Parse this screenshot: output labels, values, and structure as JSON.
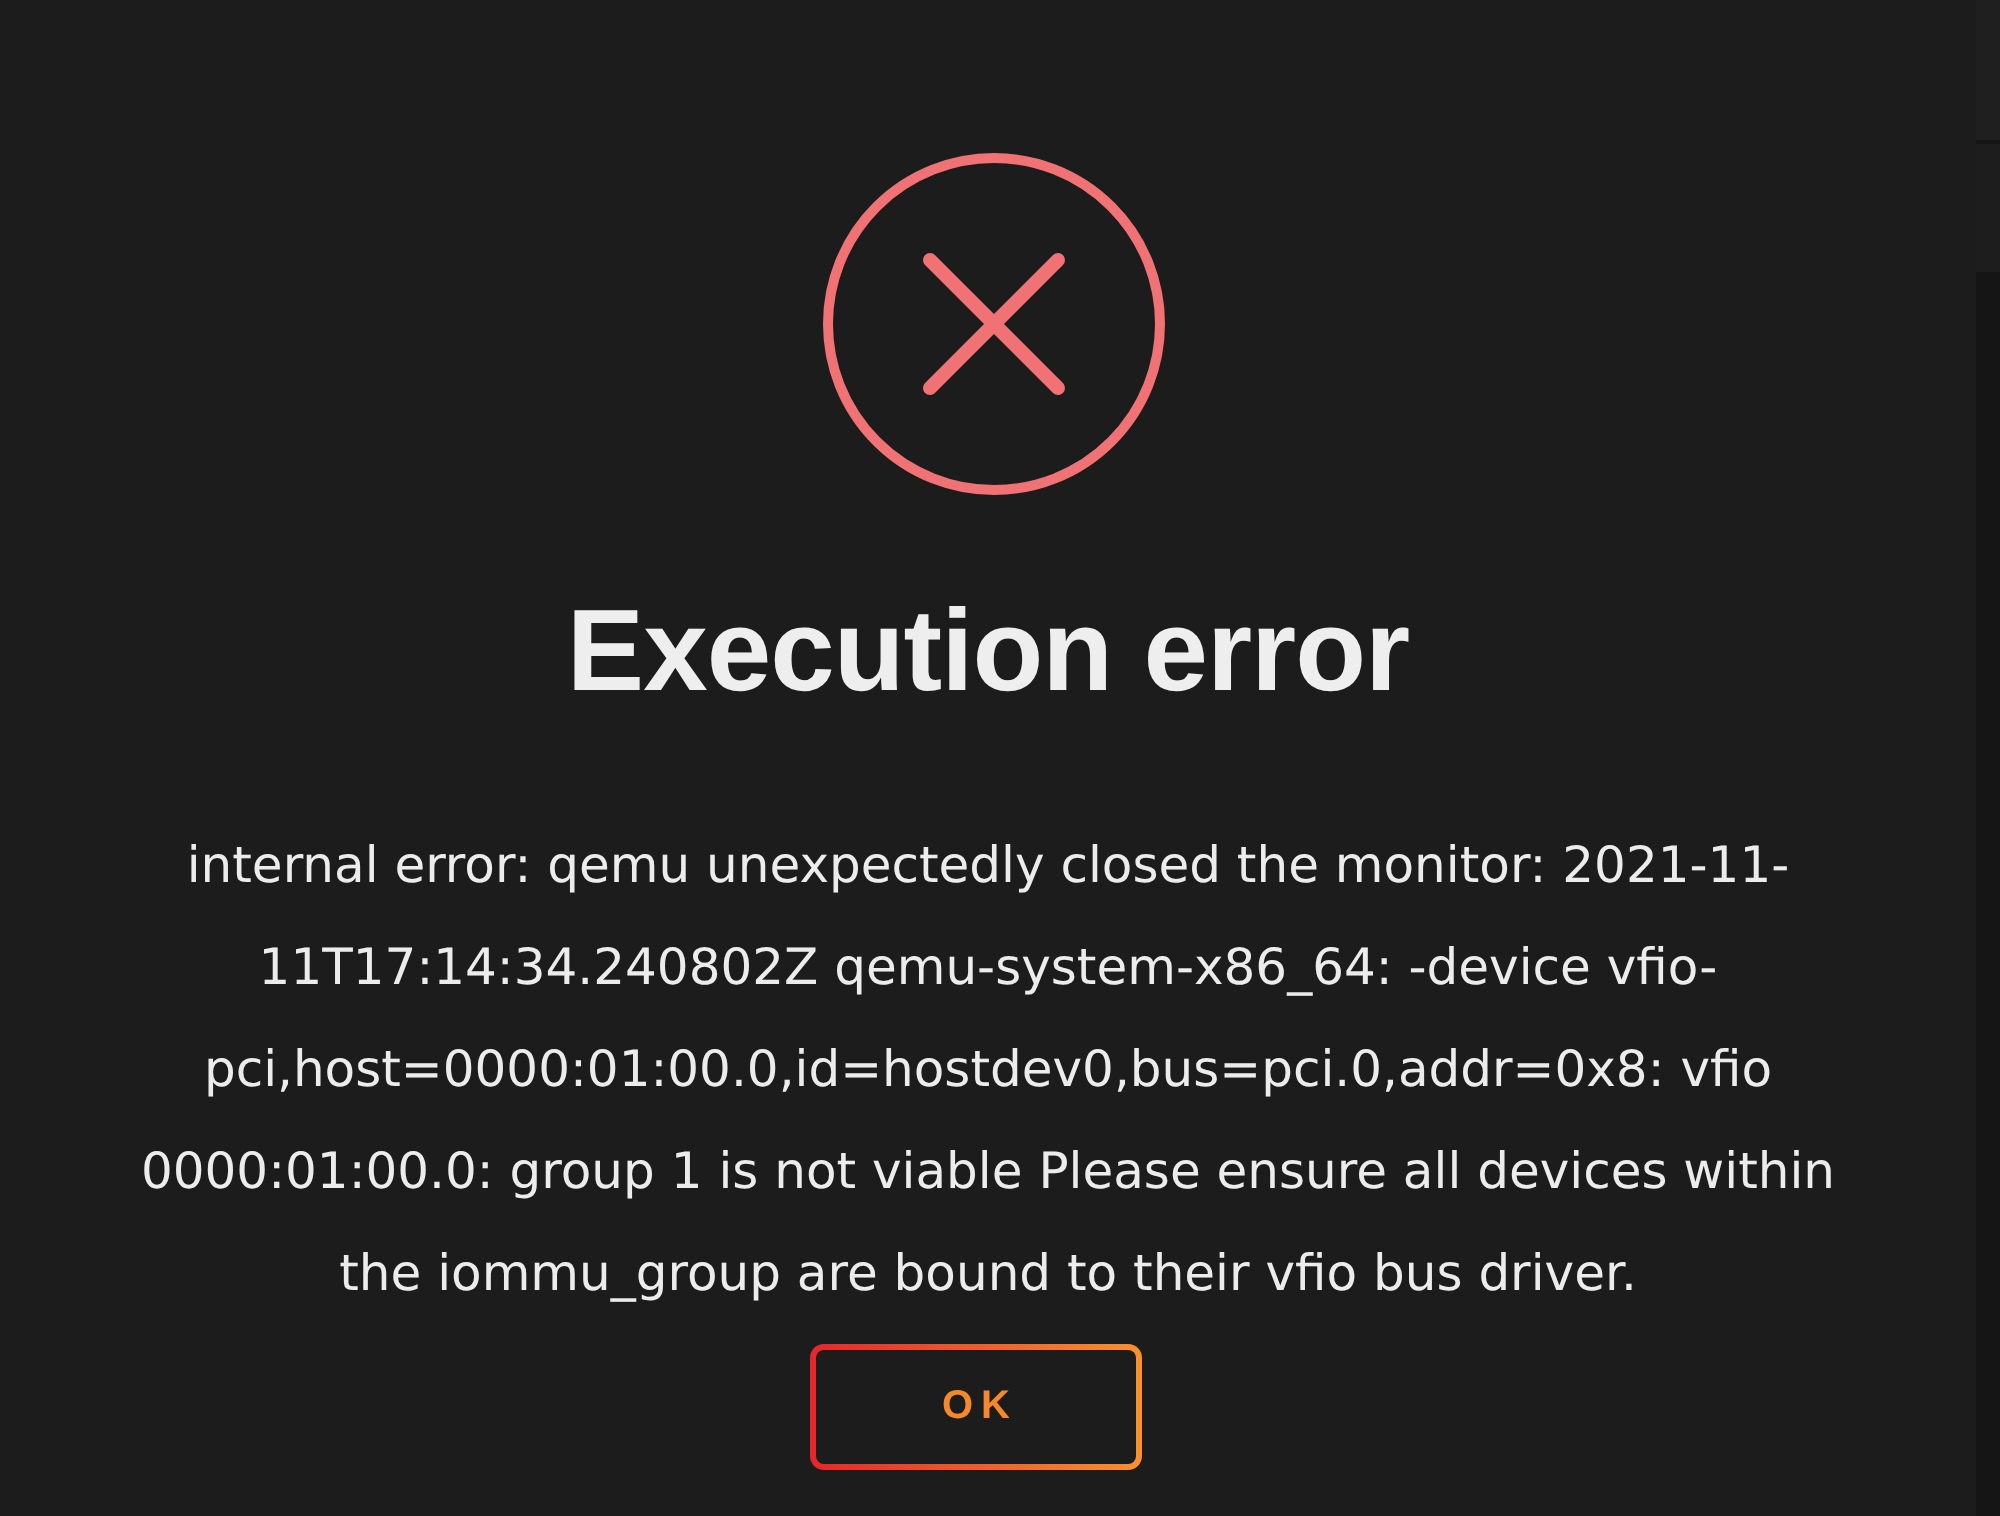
{
  "dialog": {
    "title": "Execution error",
    "message": "internal error: qemu unexpectedly closed the monitor: 2021-11-11T17:14:34.240802Z qemu-system-x86_64: -device vfio-pci,host=0000:01:00.0,id=hostdev0,bus=pci.0,addr=0x8: vfio 0000:01:00.0: group 1 is not viable Please ensure all devices within the iommu_group are bound to their vfio bus driver.",
    "buttons": [
      "OK"
    ]
  }
}
